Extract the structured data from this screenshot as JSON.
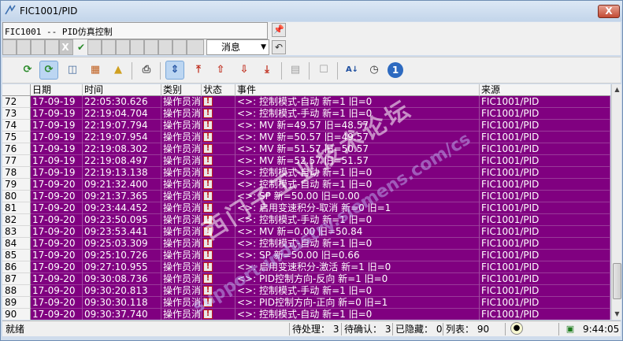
{
  "window": {
    "title": "FIC1001/PID",
    "close_label": "X"
  },
  "control": {
    "title_text": "FIC1001 -- PID仿真控制",
    "pin_icon": "pin-icon",
    "x_label": "X",
    "check_icon": "check-icon",
    "message_select": "消息",
    "undo_icon": "undo-icon"
  },
  "toolbar": {
    "icons": [
      "refresh-icon",
      "refresh-active-icon",
      "database-icon",
      "chart-icon",
      "folder-lock-icon",
      "print-icon",
      "scroll-vertical-icon",
      "move-top-icon",
      "move-up-icon",
      "move-down-icon",
      "move-bottom-icon",
      "document-icon",
      "lock-icon",
      "sort-az-icon",
      "clock-icon",
      "info-icon"
    ]
  },
  "grid": {
    "columns": [
      "日期",
      "时间",
      "类别",
      "状态",
      "事件",
      "来源"
    ],
    "rows": [
      {
        "n": "72",
        "date": "17-09-19",
        "time": "22:05:30.626",
        "cat": "操作员消",
        "event": "<>: 控制模式-自动 新=1 旧=0",
        "src": "FIC1001/PID"
      },
      {
        "n": "73",
        "date": "17-09-19",
        "time": "22:19:04.704",
        "cat": "操作员消",
        "event": "<>: 控制模式-手动 新=1 旧=0",
        "src": "FIC1001/PID"
      },
      {
        "n": "74",
        "date": "17-09-19",
        "time": "22:19:07.794",
        "cat": "操作员消",
        "event": "<>: MV 新=49.57 旧=48.57",
        "src": "FIC1001/PID"
      },
      {
        "n": "75",
        "date": "17-09-19",
        "time": "22:19:07.954",
        "cat": "操作员消",
        "event": "<>: MV 新=50.57 旧=49.57",
        "src": "FIC1001/PID"
      },
      {
        "n": "76",
        "date": "17-09-19",
        "time": "22:19:08.302",
        "cat": "操作员消",
        "event": "<>: MV 新=51.57 旧=50.57",
        "src": "FIC1001/PID"
      },
      {
        "n": "77",
        "date": "17-09-19",
        "time": "22:19:08.497",
        "cat": "操作员消",
        "event": "<>: MV 新=52.57 旧=51.57",
        "src": "FIC1001/PID"
      },
      {
        "n": "78",
        "date": "17-09-19",
        "time": "22:19:13.138",
        "cat": "操作员消",
        "event": "<>: 控制模式-自动 新=1 旧=0",
        "src": "FIC1001/PID"
      },
      {
        "n": "79",
        "date": "17-09-20",
        "time": "09:21:32.400",
        "cat": "操作员消",
        "event": "<>: 控制模式-自动 新=1 旧=0",
        "src": "FIC1001/PID"
      },
      {
        "n": "80",
        "date": "17-09-20",
        "time": "09:21:37.365",
        "cat": "操作员消",
        "event": "<>: SP 新=50.00 旧=0.00",
        "src": "FIC1001/PID"
      },
      {
        "n": "81",
        "date": "17-09-20",
        "time": "09:23:44.452",
        "cat": "操作员消",
        "event": "<>: 启用变速积分-取消 新=0 旧=1",
        "src": "FIC1001/PID"
      },
      {
        "n": "82",
        "date": "17-09-20",
        "time": "09:23:50.095",
        "cat": "操作员消",
        "event": "<>: 控制模式-手动 新=1 旧=0",
        "src": "FIC1001/PID"
      },
      {
        "n": "83",
        "date": "17-09-20",
        "time": "09:23:53.441",
        "cat": "操作员消",
        "event": "<>: MV 新=0.00 旧=50.84",
        "src": "FIC1001/PID"
      },
      {
        "n": "84",
        "date": "17-09-20",
        "time": "09:25:03.309",
        "cat": "操作员消",
        "event": "<>: 控制模式-自动 新=1 旧=0",
        "src": "FIC1001/PID"
      },
      {
        "n": "85",
        "date": "17-09-20",
        "time": "09:25:10.726",
        "cat": "操作员消",
        "event": "<>: SP 新=50.00 旧=0.66",
        "src": "FIC1001/PID"
      },
      {
        "n": "86",
        "date": "17-09-20",
        "time": "09:27:10.955",
        "cat": "操作员消",
        "event": "<>: 启用变速积分-激活 新=1 旧=0",
        "src": "FIC1001/PID"
      },
      {
        "n": "87",
        "date": "17-09-20",
        "time": "09:30:08.736",
        "cat": "操作员消",
        "event": "<>: PID控制方向-反向 新=1 旧=0",
        "src": "FIC1001/PID"
      },
      {
        "n": "88",
        "date": "17-09-20",
        "time": "09:30:20.813",
        "cat": "操作员消",
        "event": "<>: 控制模式-手动 新=1 旧=0",
        "src": "FIC1001/PID"
      },
      {
        "n": "89",
        "date": "17-09-20",
        "time": "09:30:30.118",
        "cat": "操作员消",
        "event": "<>: PID控制方向-正向 新=0 旧=1",
        "src": "FIC1001/PID"
      },
      {
        "n": "90",
        "date": "17-09-20",
        "time": "09:30:37.740",
        "cat": "操作员消",
        "event": "<>: 控制模式-自动 新=1 旧=0",
        "src": "FIC1001/PID"
      }
    ],
    "row_color": "#800080"
  },
  "watermark": {
    "line1": "西门子工业技术论坛",
    "line2": "support.industry.siemens.com/cs"
  },
  "statusbar": {
    "ready": "就绪",
    "pending": "待处理： 3",
    "to_confirm": "待确认： 3",
    "hidden": "已隐藏： 0",
    "list": "列表： 90",
    "clock": "9:44:05"
  }
}
